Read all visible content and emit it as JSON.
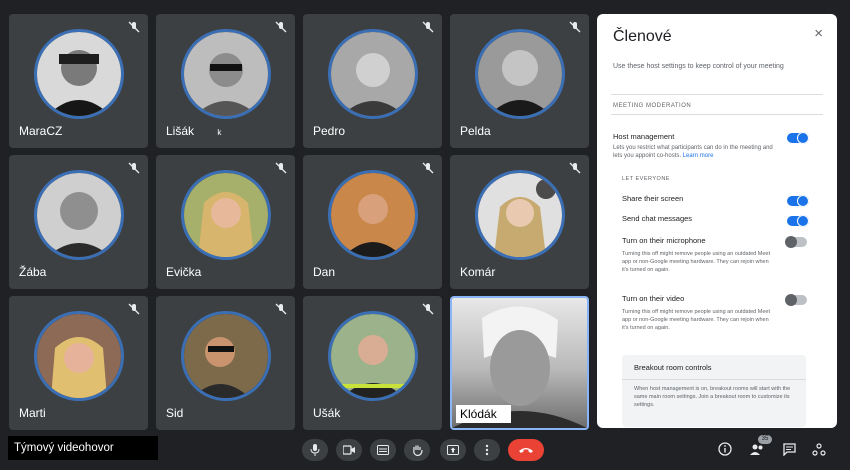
{
  "meeting": {
    "title": "Týmový videohovor"
  },
  "participants": [
    {
      "name": "MaraCZ"
    },
    {
      "name": "Lišák",
      "suffix": "k"
    },
    {
      "name": "Pedro"
    },
    {
      "name": "Pelda"
    },
    {
      "name": "Žába"
    },
    {
      "name": "Evička"
    },
    {
      "name": "Dan"
    },
    {
      "name": "Komár"
    },
    {
      "name": "Marti"
    },
    {
      "name": "Sid"
    },
    {
      "name": "Ušák"
    },
    {
      "name": "Klódák"
    }
  ],
  "panel": {
    "title": "Členové",
    "close_label": "×",
    "intro": "Use these host settings to keep control of your meeting",
    "moderation_label": "MEETING MODERATION",
    "host_management": {
      "label": "Host management",
      "desc": "Lets you restrict what participants can do in the meeting and lets you appoint co-hosts.",
      "learn_more": "Learn more",
      "on": true
    },
    "let_everyone_label": "LET EVERYONE",
    "share_screen": {
      "label": "Share their screen",
      "on": true
    },
    "send_chat": {
      "label": "Send chat messages",
      "on": true
    },
    "microphone": {
      "label": "Turn on their microphone",
      "desc": "Turning this off might remove people using an outdated Meet app or non-Google meeting hardware. They can rejoin when it's turned on again.",
      "on": false
    },
    "video": {
      "label": "Turn on their video",
      "desc": "Turning this off might remove people using an outdated Meet app or non-Google meeting hardware. They can rejoin when it's turned on again.",
      "on": false
    },
    "breakout": {
      "title": "Breakout room controls",
      "desc": "When host management is on, breakout rooms will start with the same main room settings. Join a breakout room to customize its settings."
    }
  },
  "people_count": "35",
  "colors": {
    "accent": "#1a73e8",
    "end_call": "#ea4335",
    "avatar_ring": "#3b6fb5"
  },
  "icons": [
    "mic-icon",
    "camera-icon",
    "captions-icon",
    "raise-hand-icon",
    "present-icon",
    "more-vert-icon",
    "end-call-icon",
    "info-icon",
    "people-icon",
    "chat-icon",
    "activities-icon",
    "mic-off-icon"
  ]
}
